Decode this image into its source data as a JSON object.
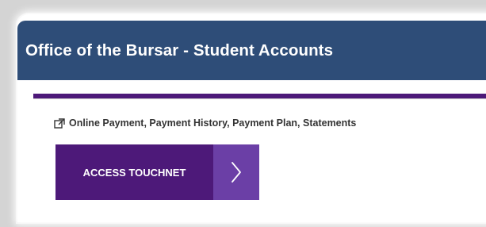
{
  "header": {
    "title": "Office of the Bursar - Student Accounts"
  },
  "content": {
    "link_icon": "external-link-icon",
    "link_text": "Online Payment, Payment History, Payment Plan, Statements",
    "button_label": "ACCESS TOUCHNET",
    "button_icon": "chevron-right-icon"
  },
  "colors": {
    "header_bg": "#2e4d78",
    "accent_purple": "#4d1979",
    "arrow_purple": "#6b3fa6"
  }
}
